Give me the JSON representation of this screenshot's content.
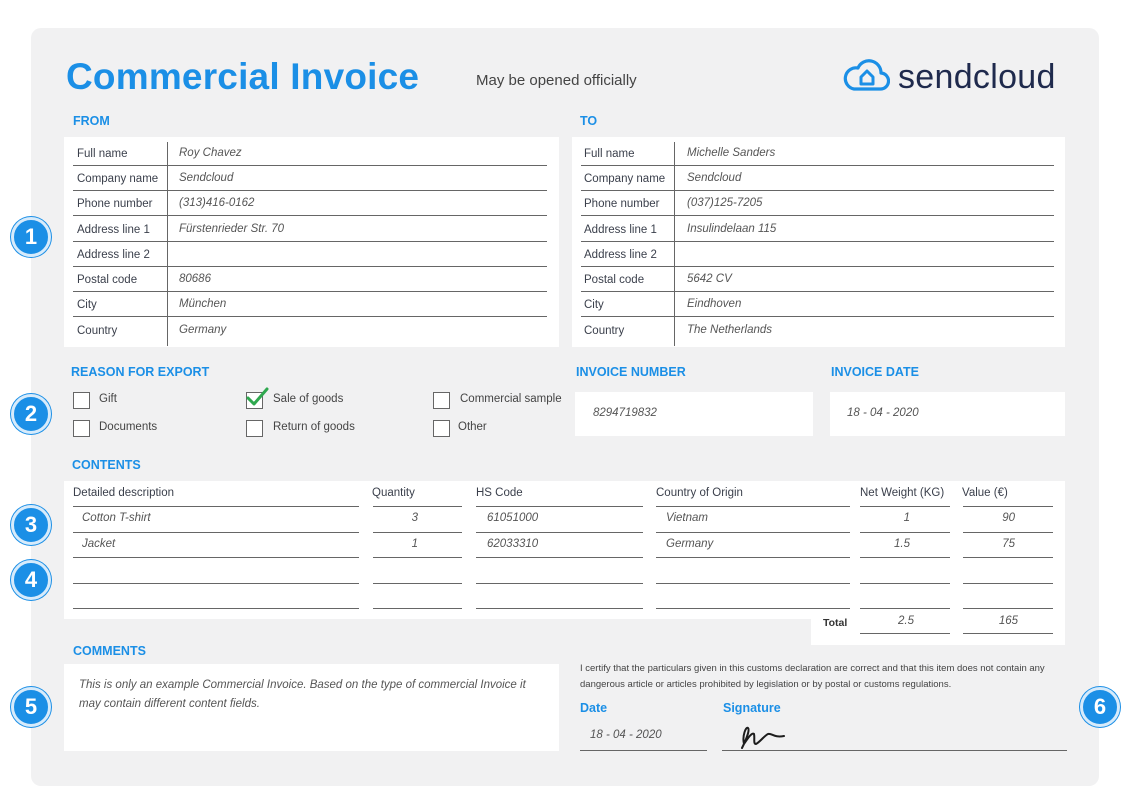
{
  "header": {
    "title": "Commercial Invoice",
    "subtitle": "May be opened officially",
    "brand": "sendcloud",
    "brand_icon": "cloud-home-icon",
    "accent": "#1b8fe6"
  },
  "from": {
    "heading": "FROM",
    "rows": [
      {
        "label": "Full name",
        "value": "Roy Chavez"
      },
      {
        "label": "Company name",
        "value": "Sendcloud"
      },
      {
        "label": "Phone number",
        "value": "(313)416-0162"
      },
      {
        "label": "Address line 1",
        "value": "Fürstenrieder Str. 70"
      },
      {
        "label": "Address line 2",
        "value": ""
      },
      {
        "label": "Postal code",
        "value": "80686"
      },
      {
        "label": "City",
        "value": "München"
      },
      {
        "label": "Country",
        "value": "Germany"
      }
    ]
  },
  "to": {
    "heading": "TO",
    "rows": [
      {
        "label": "Full name",
        "value": "Michelle Sanders"
      },
      {
        "label": "Company name",
        "value": "Sendcloud"
      },
      {
        "label": "Phone number",
        "value": "(037)125-7205"
      },
      {
        "label": "Address line 1",
        "value": "Insulindelaan 115"
      },
      {
        "label": "Address line 2",
        "value": ""
      },
      {
        "label": "Postal code",
        "value": "5642 CV"
      },
      {
        "label": "City",
        "value": "Eindhoven"
      },
      {
        "label": "Country",
        "value": "The Netherlands"
      }
    ]
  },
  "reason": {
    "heading": "REASON FOR EXPORT",
    "options": [
      {
        "label": "Gift",
        "checked": false
      },
      {
        "label": "Documents",
        "checked": false
      },
      {
        "label": "Sale of goods",
        "checked": true
      },
      {
        "label": "Return of goods",
        "checked": false
      },
      {
        "label": "Commercial sample",
        "checked": false
      },
      {
        "label": "Other",
        "checked": false
      }
    ]
  },
  "invoice_number": {
    "heading": "INVOICE NUMBER",
    "value": "8294719832"
  },
  "invoice_date": {
    "heading": "INVOICE DATE",
    "value": "18 - 04 - 2020"
  },
  "contents": {
    "heading": "CONTENTS",
    "columns": [
      "Detailed description",
      "Quantity",
      "HS Code",
      "Country of Origin",
      "Net Weight (KG)",
      "Value (€)"
    ],
    "rows": [
      [
        "Cotton T-shirt",
        "3",
        "61051000",
        "Vietnam",
        "1",
        "90"
      ],
      [
        "Jacket",
        "1",
        "62033310",
        "Germany",
        "1.5",
        "75"
      ],
      [
        "",
        "",
        "",
        "",
        "",
        ""
      ],
      [
        "",
        "",
        "",
        "",
        "",
        ""
      ]
    ],
    "total_label": "Total",
    "total_weight": "2.5",
    "total_value": "165"
  },
  "comments": {
    "heading": "COMMENTS",
    "text": "This is only an example Commercial Invoice. Based on the type of commercial Invoice it may contain different content fields."
  },
  "certification": {
    "text": "I certify that the particulars given in this customs declaration are correct and that this item does not contain any dangerous article or articles prohibited by legislation or by postal or customs regulations.",
    "date_label": "Date",
    "date_value": "18 - 04 - 2020",
    "signature_label": "Signature"
  },
  "badges": [
    "1",
    "2",
    "3",
    "4",
    "5",
    "6"
  ]
}
